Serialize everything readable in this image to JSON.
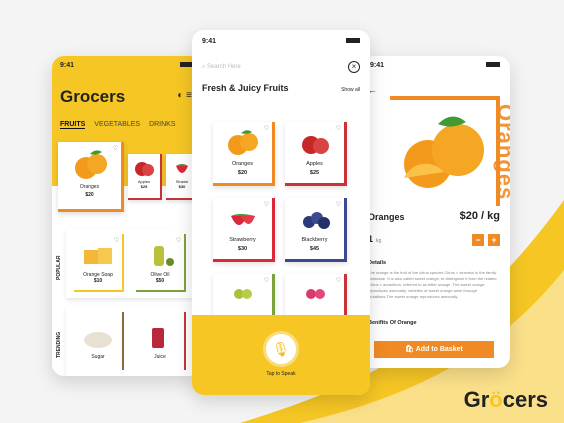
{
  "colors": {
    "yellow": "#f6c624",
    "orange": "#f08a24",
    "red": "#c6343a",
    "blue": "#3b4a8f",
    "green": "#7ba33a"
  },
  "left": {
    "time": "9:41",
    "brand": "Grocers",
    "tabs": [
      "FRUITS",
      "VEGETABLES",
      "DRINKS"
    ],
    "featured": {
      "name": "Oranges",
      "price": "$20"
    },
    "small_items": [
      {
        "name": "Apples",
        "price": "$25"
      },
      {
        "name": "Strawb",
        "price": "$30"
      }
    ],
    "popular_label": "POPULAR",
    "trending_label": "TRENDING",
    "popular": [
      {
        "name": "Orange Soap",
        "price": "$10"
      },
      {
        "name": "Olive Oil",
        "price": "$50"
      }
    ],
    "trending": [
      {
        "name": "Sugar"
      },
      {
        "name": "Juice"
      }
    ]
  },
  "center": {
    "time": "9:41",
    "search_placeholder": "Search Here",
    "title": "Fresh & Juicy Fruits",
    "show_all": "Show all",
    "items": [
      {
        "name": "Oranges",
        "price": "$20"
      },
      {
        "name": "Apples",
        "price": "$25"
      },
      {
        "name": "Strawberry",
        "price": "$30"
      },
      {
        "name": "Blackberry",
        "price": "$45"
      }
    ],
    "voice_label": "Tap to Speak"
  },
  "right": {
    "time": "9:41",
    "vertical_word": "Oranges",
    "name": "Oranges",
    "price": "$20 / kg",
    "qty": "1",
    "unit": "kg",
    "details_heading": "Details",
    "details_text": "The orange is the fruit of the citrus species Citrus × sinensis in the family Rutaceae. It is also called sweet orange, to distinguish it from the related Citrus × aurantium, referred to as bitter orange. The sweet orange reproduces asexually; varieties of sweet orange arise through mutations.The sweet orange reproduces asexually.",
    "benefits_heading": "Benifits Of Orange",
    "basket_label": "Add to Basket"
  },
  "footer_brand": {
    "pre": "Gr",
    "o": "ö",
    "post": "cers"
  }
}
